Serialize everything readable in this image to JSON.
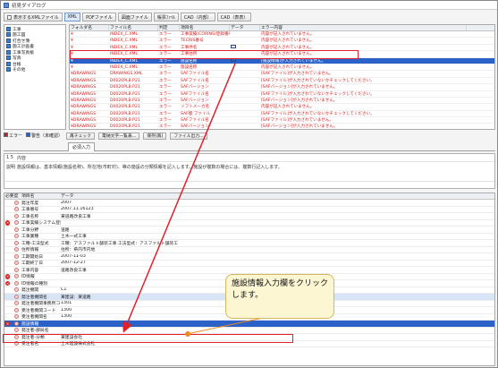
{
  "window": {
    "title": "初見ダイアログ"
  },
  "toolbar": {
    "checkbox_label": "表示するXMLファイル",
    "buttons": [
      "XML",
      "PDFファイル",
      "図面ファイル",
      "帳票ﾌｧｲﾙ",
      "CAD（内部）",
      "CAD（表表）"
    ],
    "active_index": 0
  },
  "tree": {
    "items": [
      "工事",
      "施工図",
      "打合せ簿",
      "施工計画書",
      "工事写真帳",
      "写真",
      "台帳",
      "その他"
    ]
  },
  "grid": {
    "headers": [
      "フォルダ名",
      "ファイル名",
      "判定",
      "項目名",
      "データ",
      "エラー内容"
    ],
    "rows": [
      [
        "¥",
        "INDEX_C.XML",
        "エラー",
        "工事実績(CORINS)登録番号",
        "",
        "内容が記入されていません。"
      ],
      [
        "¥",
        "INDEX_C.XML",
        "エラー",
        "TECRIS番号",
        "",
        "内容が記入されていません。"
      ],
      [
        "¥",
        "INDEX_C.XML",
        "エラー",
        "工事件名",
        "",
        "内容が記入されていません。"
      ],
      [
        "¥",
        "INDEX_C.XML",
        "エラー",
        "工事住所",
        "",
        "内容が記入されていません。"
      ],
      [
        "¥",
        "INDEX_C.XML",
        "エラー",
        "施設名称",
        "",
        "[施設情報]が入力されていません。"
      ],
      [
        "¥",
        "INDEX_C.XML",
        "エラー",
        "施設名称",
        "",
        "内容が記入されていません。"
      ],
      [
        "¥DRAWINGS",
        "DRAWINGS.XML",
        "エラー",
        "SAFファイル名",
        "",
        "[SAFファイル]が入力されていません。"
      ],
      [
        "¥DRAWINGS",
        "D0020PLB.P21",
        "エラー",
        "SAFファイル名",
        "",
        "[SAFファイル]が入力されていないかチェックしてください。"
      ],
      [
        "¥DRAWINGS",
        "D0020PLB.P21",
        "エラー",
        "SAFバージョン",
        "",
        "[SAFバージョン]が入力されていません。"
      ],
      [
        "¥DRAWINGS",
        "D0020PLB.P21",
        "エラー",
        "SAFファイル名",
        "",
        "[SAFファイル]が入力されていないかチェックしてください。"
      ],
      [
        "¥DRAWINGS",
        "D0020PLB.P21",
        "エラー",
        "SAFバージョン",
        "",
        "[SAFバージョン]が入力されていません。"
      ],
      [
        "¥DRAWINGS",
        "D0020PLB.P21",
        "エラー",
        "ソフトメーカ名",
        "",
        "内容が記入されていません。"
      ],
      [
        "¥DRAWINGS",
        "D0020PLB.P21",
        "エラー",
        "SAF版 ファイル",
        "",
        "[SAFファイル]が入力されていないかチェックしてください。"
      ],
      [
        "¥DRAWINGS",
        "D0020PLB.P21",
        "エラー",
        "SAFファイル名",
        "",
        "[SAFファイル]が入力されていません。"
      ],
      [
        "¥DRAWINGS",
        "D0020PLB.P21",
        "エラー",
        "SAFバージョン",
        "",
        "[SAFバージョン]が入力されていません。"
      ]
    ],
    "selected_index": 4
  },
  "bottom_bar": {
    "error_label": "エラー",
    "warn_label": "警告（未確認）",
    "buttons": [
      "再チェック",
      "電納文字一覧表...",
      "保存(再)",
      "ファイル出力..."
    ]
  },
  "tabs": [
    "必須入力"
  ],
  "detail": {
    "row1_label": "1 5",
    "row1_value": "内容",
    "row2_label": "説明",
    "row2_value": "施設情報は、基本情報(施設名称)、所在地(市町村)、等の施設の分類情報を記入します。施設が複数の場合には、複数行記入します。"
  },
  "props": {
    "headers": [
      "必要度",
      "項目名",
      "データ"
    ],
    "rows": [
      {
        "icon": "none",
        "name": "発注年度",
        "value": "2007"
      },
      {
        "icon": "none",
        "name": "工事番号",
        "value": "2007.11.16123"
      },
      {
        "icon": "none",
        "name": "工事名称",
        "value": "某道路改良工事"
      },
      {
        "icon": "err",
        "name": "工事実績システム登録番号",
        "value": ""
      },
      {
        "icon": "none",
        "name": "工事分野",
        "value": "道路"
      },
      {
        "icon": "none",
        "name": "工事業種",
        "value": "土木一式工事"
      },
      {
        "icon": "none",
        "name": "工種-工法型式",
        "value": "工種：アスファルト舗装工事 工法型式：アスファルト舗装工"
      },
      {
        "icon": "none",
        "name": "住所情報",
        "value": "住所：県内市内地"
      },
      {
        "icon": "none",
        "name": "工期開始日",
        "value": "2007-11-03"
      },
      {
        "icon": "none",
        "name": "工期終了日",
        "value": "2007-12-27"
      },
      {
        "icon": "none",
        "name": "工事内容",
        "value": "道路改良工事"
      },
      {
        "icon": "err",
        "name": "ID情報",
        "value": ""
      },
      {
        "icon": "err",
        "name": "ID情報の種別",
        "value": ""
      },
      {
        "icon": "none",
        "name": "発注機関",
        "value": "C1"
      },
      {
        "icon": "none",
        "name": "発注者機関名",
        "value": "某建設：某道路"
      },
      {
        "icon": "none",
        "name": "発注者機関事務所コード",
        "value": "1301"
      },
      {
        "icon": "none",
        "name": "受注者機関コード",
        "value": "1300"
      },
      {
        "icon": "none",
        "name": "受注者機関名",
        "value": "1300"
      },
      {
        "icon": "err",
        "name": "施設情報",
        "value": ""
      },
      {
        "icon": "none",
        "name": "発注者-部局名",
        "value": ""
      },
      {
        "icon": "none",
        "name": "発注者-分類",
        "value": "某建設会社"
      },
      {
        "icon": "none",
        "name": "受注者名",
        "value": "土木建設株式会社"
      }
    ],
    "selected_index": 18,
    "blue_index": 14
  },
  "callout": {
    "text": "施設情報入力欄をクリックします。"
  }
}
